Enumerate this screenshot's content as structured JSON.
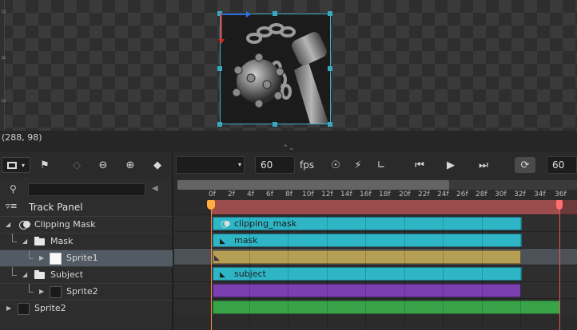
{
  "viewport": {
    "ruler_marks": [
      "0",
      "0",
      "0"
    ],
    "cursor_coords": "(288, 98)"
  },
  "toolbar": {
    "fps_value": "60",
    "fps_label": "fps",
    "end_frame_value": "60"
  },
  "track_panel": {
    "title": "Track Panel",
    "tree": [
      {
        "label": "Clipping Mask"
      },
      {
        "label": "Mask"
      },
      {
        "label": "Sprite1"
      },
      {
        "label": "Subject"
      },
      {
        "label": "Sprite2"
      },
      {
        "label": "Sprite2"
      }
    ]
  },
  "timeline": {
    "ticks": [
      "0f",
      "2f",
      "4f",
      "6f",
      "8f",
      "10f",
      "12f",
      "14f",
      "16f",
      "18f",
      "20f",
      "22f",
      "24f",
      "26f",
      "28f",
      "30f",
      "32f",
      "34f",
      "36f"
    ],
    "clips": [
      "clipping_mask",
      "mask",
      "",
      "subject",
      "",
      ""
    ]
  },
  "colors": {
    "accent": "#37a9c0",
    "range": "#9b4c4c",
    "clip_cyan": "#2eb6c6",
    "clip_gold": "#b59f54",
    "clip_purple": "#7b3fb0",
    "clip_green": "#39a349",
    "playhead": "#ff8a3c"
  }
}
